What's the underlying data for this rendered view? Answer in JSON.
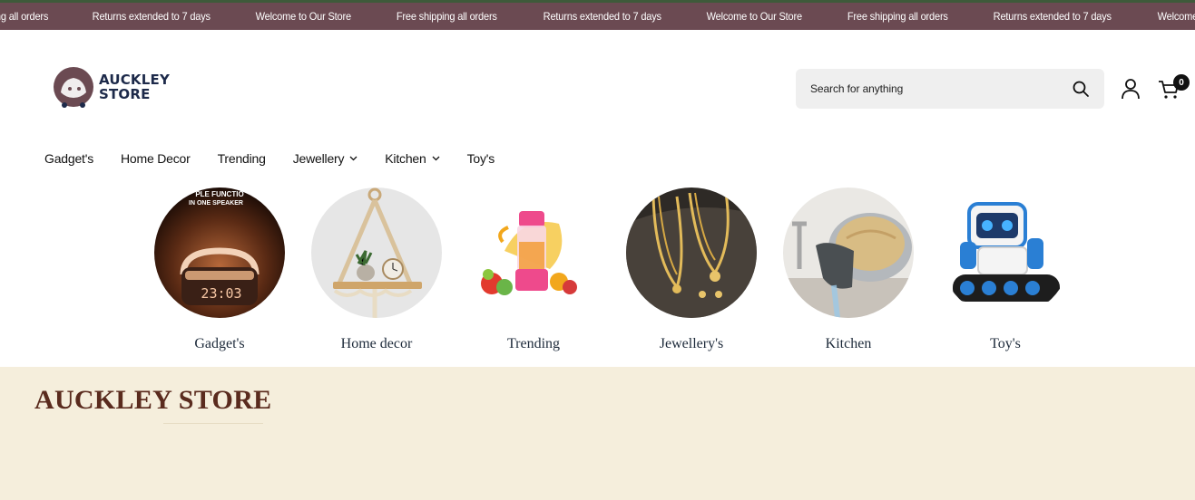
{
  "announcement": {
    "items": [
      "ing all orders",
      "Returns extended to 7 days",
      "Welcome to Our Store",
      "Free shipping all orders",
      "Returns extended to 7 days",
      "Welcome to Our Store",
      "Free shipping all orders",
      "Returns extended to 7 days",
      "Welcome to Our Store"
    ]
  },
  "header": {
    "logo_line1": "AUCKLEY",
    "logo_line2": "STORE",
    "search_placeholder": "Search for anything",
    "cart_count": "0"
  },
  "nav": {
    "items": [
      {
        "label": "Gadget's",
        "has_dropdown": false
      },
      {
        "label": "Home Decor",
        "has_dropdown": false
      },
      {
        "label": "Trending",
        "has_dropdown": false
      },
      {
        "label": "Jewellery",
        "has_dropdown": true
      },
      {
        "label": "Kitchen",
        "has_dropdown": true
      },
      {
        "label": "Toy's",
        "has_dropdown": false
      }
    ]
  },
  "categories": [
    {
      "label": "Gadget's",
      "clock": "23:03",
      "speaker_text_1": "PLE FUNCTIO",
      "speaker_text_2": "IN ONE SPEAKER"
    },
    {
      "label": "Home decor"
    },
    {
      "label": "Trending"
    },
    {
      "label": "Jewellery's"
    },
    {
      "label": "Kitchen"
    },
    {
      "label": "Toy's"
    }
  ],
  "brand": {
    "title": "AUCKLEY STORE"
  },
  "colors": {
    "announcement_bg": "#6b4a52",
    "brand_bg": "#f5eedc",
    "brand_title": "#5a2b1e",
    "logo_text": "#1d2a4a"
  }
}
